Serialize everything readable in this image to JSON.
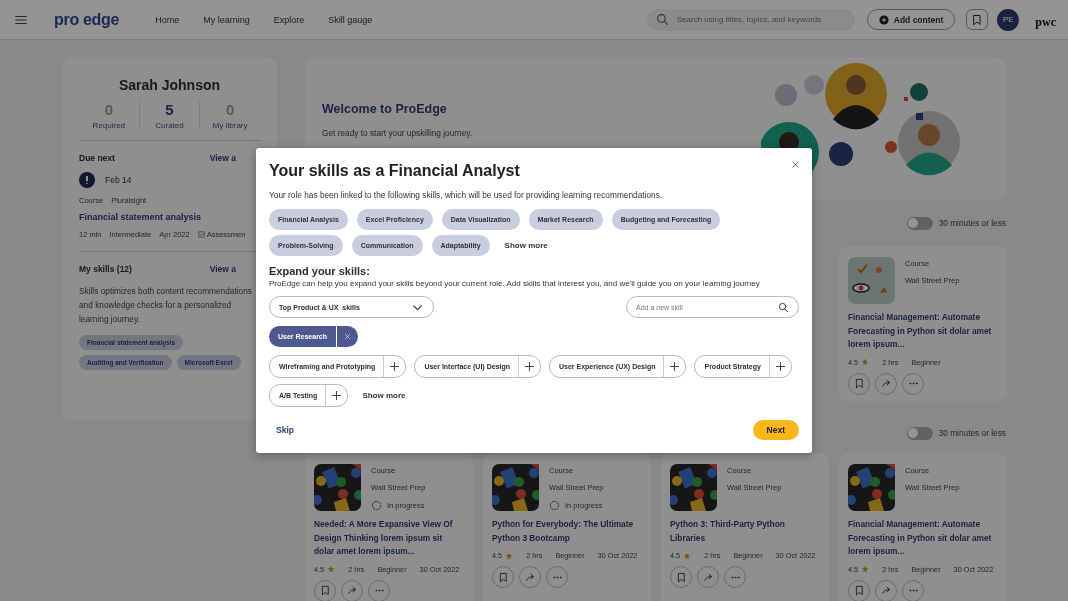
{
  "header": {
    "logo": "pro edge",
    "nav": [
      "Home",
      "My learning",
      "Explore",
      "Skill gauge"
    ],
    "search": {
      "placeholder": "Search using titles, topics, and keywords"
    },
    "add_button": "Add content",
    "avatar": "PE",
    "brand": "pwc"
  },
  "profile": {
    "name": "Sarah Johnson",
    "stats": [
      {
        "value": "0",
        "label": "Required",
        "selected": false
      },
      {
        "value": "5",
        "label": "Curated",
        "selected": true
      },
      {
        "value": "0",
        "label": "My library",
        "selected": false
      }
    ],
    "due_next": {
      "title": "Due next",
      "link": "View a",
      "date": "Feb 14",
      "type": "Course",
      "provider": "Pluralsight",
      "course": "Financial statement analysis",
      "meta": [
        "12 min",
        "Intermediate",
        "Apr 2022"
      ],
      "assessment": "Assessmen"
    },
    "skills": {
      "title": "My skills (12)",
      "link": "View a",
      "description": "Skills optimizes both content recommendations and knowledge checks for a personalized learning journey.",
      "tags": [
        "Financial statement analysis",
        "Auditing and Verification",
        "Microsoft Excel"
      ]
    }
  },
  "welcome": {
    "title": "Welcome to ProEdge",
    "text": "Get ready to start your upskilling journey."
  },
  "sections": [
    {
      "toggle": {
        "label": "30 minutes or less",
        "on": false
      },
      "cards": [
        {
          "kind": "sketch",
          "type": "Course",
          "provider": "Wall Street Prep",
          "title": "Financial Management: Automate Forecasting in Python sit dolar amet lorem ipsum...",
          "rating": "4.5",
          "duration": "2 hrs",
          "level": "Beginner"
        }
      ]
    },
    {
      "toggle": {
        "label": "30 minutes or less",
        "on": false
      },
      "cards": [
        {
          "kind": "shapes",
          "type": "Course",
          "provider": "Wall Street Prep",
          "status": "In progress",
          "title": "Needed: A More Expansive View Of Design Thinking lorem ipsum  sit dolar amet lorem ipsum...",
          "rating": "4.5",
          "duration": "2 hrs",
          "level": "Beginner",
          "date": "30 Oct 2022"
        },
        {
          "kind": "shapes",
          "type": "Course",
          "provider": "Wall Street Prep",
          "status": "In progress",
          "title": "Python for Everybody: The Ultimate Python 3 Bootcamp",
          "rating": "4.5",
          "duration": "2 hrs",
          "level": "Beginner",
          "date": "30 Oct 2022"
        },
        {
          "kind": "shapes",
          "type": "Course",
          "provider": "Wall Street Prep",
          "title": "Python 3: Third-Party Python Libraries",
          "rating": "4.5",
          "duration": "2 hrs",
          "level": "Beginner",
          "date": "30 Oct 2022"
        },
        {
          "kind": "shapes",
          "type": "Course",
          "provider": "Wall Street Prep",
          "title": "Financial Management: Automate Forecasting in Python sit dolar amet lorem ipsum...",
          "rating": "4.5",
          "duration": "2 hrs",
          "level": "Beginner",
          "date": "30 Oct 2022"
        }
      ]
    }
  ],
  "modal": {
    "title": "Your skills as a Financial Analyst",
    "intro": "Your role has been linked to the following skills, which will be used for providing learning recommendations.",
    "role_skills": [
      "Financial Analysis",
      "Excel Proficiency",
      "Data Visualization",
      "Market Research",
      "Budgeting and Forecasting",
      "Problem-Solving",
      "Communication",
      "Adaptability"
    ],
    "show_more": "Show more",
    "expand_title": "Expand your skills:",
    "expand_text": "ProEdge can help you expand your skills beyond your current role. Add skills that interest you, and we'll guide you on your learning journey",
    "category": "Top Product & UX  skills",
    "skill_search": {
      "placeholder": "Add a new skill"
    },
    "chosen": [
      "User Research"
    ],
    "suggested": [
      "Wireframing and Prototyping",
      "User Interface (UI) Design",
      "User Experience (UX) Design",
      "Product Strategy",
      "A/B Testing"
    ],
    "show_more_2": "Show more",
    "skip": "Skip",
    "next": "Next"
  }
}
